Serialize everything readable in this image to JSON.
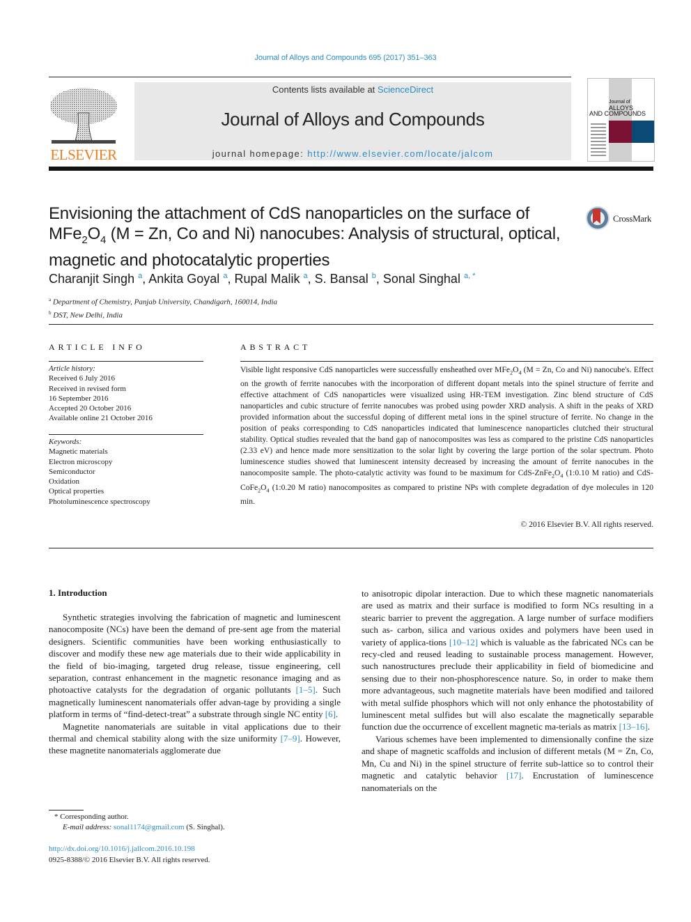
{
  "header": {
    "citation": "Journal of Alloys and Compounds 695 (2017) 351–363",
    "publisher_logo": "ELSEVIER",
    "contents_prefix": "Contents lists available at ",
    "contents_link": "ScienceDirect",
    "journal_title": "Journal of Alloys and Compounds",
    "homepage_prefix": "journal homepage: ",
    "homepage_link": "http://www.elsevier.com/locate/jalcom",
    "cover": {
      "line1": "Journal of",
      "line2": "ALLOYS",
      "line3": "AND COMPOUNDS",
      "colors": {
        "red": "#7c1233",
        "blue": "#0b4a75"
      }
    },
    "accent_link_color": "#2a8cc4",
    "logo_color": "#ee7d1e"
  },
  "article": {
    "title_line1": "Envisioning the attachment of CdS nanoparticles on the surface of",
    "title_line2_pre": "MFe",
    "title_line2_sub1": "2",
    "title_line2_mid": "O",
    "title_line2_sub2": "4",
    "title_line2_post": " (M = Zn, Co and Ni) nanocubes: Analysis of structural, optical,",
    "title_line3": "magnetic and photocatalytic properties",
    "crossmark_label": "CrossMark",
    "authors": [
      {
        "name": "Charanjit Singh",
        "aff": "a"
      },
      {
        "name": "Ankita Goyal",
        "aff": "a"
      },
      {
        "name": "Rupal Malik",
        "aff": "a"
      },
      {
        "name": "S. Bansal",
        "aff": "b"
      },
      {
        "name": "Sonal Singhal",
        "aff": "a, *"
      }
    ],
    "affiliations": [
      {
        "mark": "a",
        "text": "Department of Chemistry, Panjab University, Chandigarh, 160014, India"
      },
      {
        "mark": "b",
        "text": "DST, New Delhi, India"
      }
    ]
  },
  "article_info": {
    "heading": "ARTICLE INFO",
    "history_label": "Article history:",
    "history": [
      "Received 6 July 2016",
      "Received in revised form",
      "16 September 2016",
      "Accepted 20 October 2016",
      "Available online 21 October 2016"
    ],
    "keywords_label": "Keywords:",
    "keywords": [
      "Magnetic materials",
      "Electron microscopy",
      "Semiconductor",
      "Oxidation",
      "Optical properties",
      "Photoluminescence spectroscopy"
    ]
  },
  "abstract": {
    "heading": "ABSTRACT",
    "p1": "Visible light responsive CdS nanoparticles were successfully ensheathed over MFe",
    "p2": " (M = Zn, Co and Ni) nanocube's. Effect on the growth of ferrite nanocubes with the incorporation of different dopant metals into the spinel structure of ferrite and effective attachment of CdS nanoparticles were visualized using HR-TEM investigation. Zinc blend structure of CdS nanoparticles and cubic structure of ferrite nanocubes was probed using powder XRD analysis. A shift in the peaks of XRD provided information about the successful doping of different metal ions in the spinel structure of ferrite. No change in the position of peaks corresponding to CdS nanoparticles indicated that luminescence nanoparticles clutched their structural stability. Optical studies revealed that the band gap of nanocomposites was less as compared to the pristine CdS nanoparticles (2.33 eV) and hence made more sensitization to the solar light by covering the large portion of the solar spectrum. Photo luminescence studies showed that luminescent intensity decreased by increasing the amount of ferrite nanocubes in the nanocomposite sample. The photo-catalytic activity was found to be maximum for CdS-ZnFe",
    "p3": " (1:0.10 M ratio) and CdS-CoFe",
    "p4": " (1:0.20 M ratio) nanocomposites as compared to pristine NPs with complete degradation of dye molecules in 120 min.",
    "copyright": "© 2016 Elsevier B.V. All rights reserved."
  },
  "body": {
    "section_heading": "1.  Introduction",
    "left_p1_a": "Synthetic strategies involving the fabrication of magnetic and luminescent nanocomposite (NCs) have been the demand of pre-sent age from the material designers. Scientific communities have been working enthusiastically to discover and modify these new age materials due to their wide applicability in the field of bio-imaging, targeted drug release, tissue engineering, cell separation, contrast enhancement in the magnetic resonance imaging and as photoactive catalysts for the degradation of organic pollutants ",
    "ref_1_5": "[1–5]",
    "left_p1_b": ". Such magnetically luminescent nanomaterials offer advan-tage by providing a single platform in terms of “find-detect-treat” a substrate through single NC entity ",
    "ref_6": "[6]",
    "left_p1_c": ".",
    "left_p2_a": "Magnetite nanomaterials are suitable in vital applications due to their thermal and chemical stability along with the size uniformity ",
    "ref_7_9": "[7–9]",
    "left_p2_b": ". However, these magnetite nanomaterials agglomerate due",
    "right_p1_a": "to anisotropic dipolar interaction. Due to which these magnetic nanomaterials are used as matrix and their surface is modified to form NCs resulting in a stearic barrier to prevent the aggregation. A large number of surface modifiers such as- carbon, silica and various oxides and polymers have been used in variety of applica-tions ",
    "ref_10_12": "[10–12]",
    "right_p1_b": " which is valuable as the fabricated NCs can be recy-cled and reused leading to sustainable process management. However, such nanostructures preclude their applicability in field of biomedicine and sensing due to their non-phosphorescence nature. So, in order to make them more advantageous, such magnetite materials have been modified and tailored with metal sulfide phosphors which will not only enhance the photostability of luminescent metal sulfides but will also escalate the magnetically separable function due the occurrence of excellent magnetic ma-terials as matrix ",
    "ref_13_16": "[13–16]",
    "right_p1_c": ".",
    "right_p2_a": "Various schemes have been implemented to dimensionally confine the size and shape of magnetic scaffolds and inclusion of different metals (M = Zn, Co, Mn, Cu and Ni) in the spinel structure of ferrite sub-lattice so to control their magnetic and catalytic behavior ",
    "ref_17": "[17]",
    "right_p2_b": ". Encrustation of luminescence nanomaterials on the"
  },
  "footnote": {
    "corresponding": "*  Corresponding author.",
    "email_label": "E-mail address: ",
    "email": "sonal1174@gmail.com",
    "email_suffix": " (S. Singhal).",
    "doi": "http://dx.doi.org/10.1016/j.jallcom.2016.10.198",
    "issn": "0925-8388/© 2016 Elsevier B.V. All rights reserved."
  }
}
